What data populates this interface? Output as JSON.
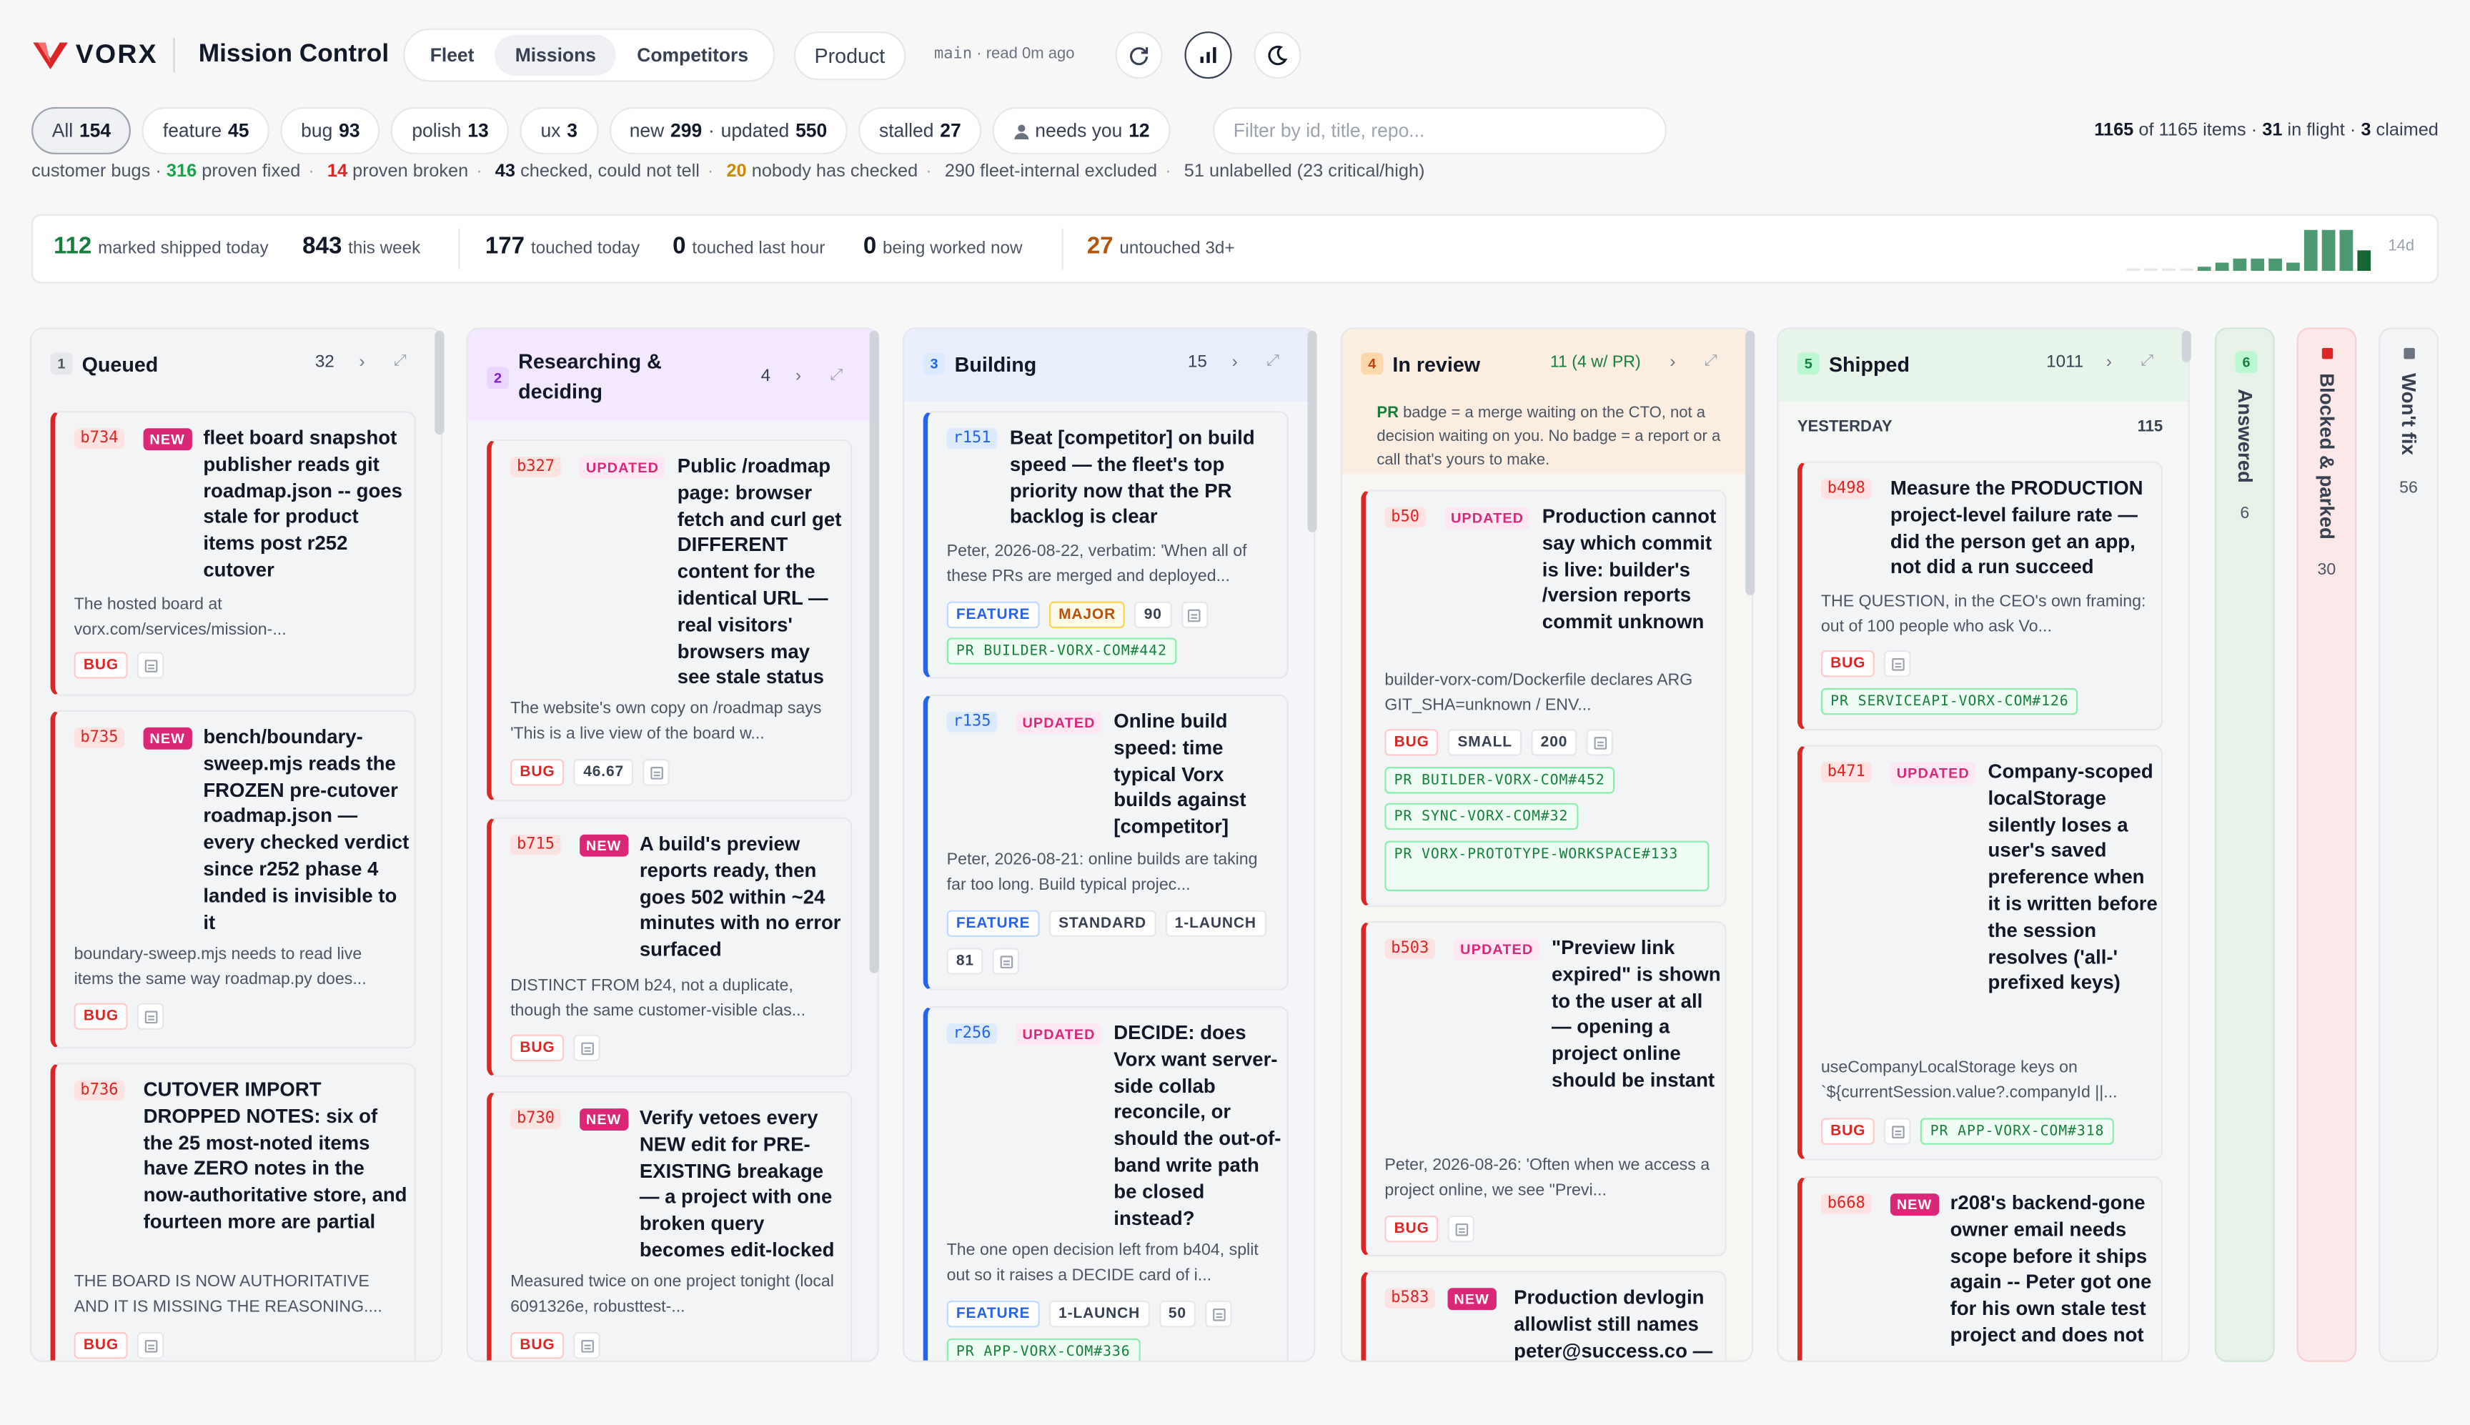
{
  "brand": {
    "wordmark": "VORX",
    "app_title": "Mission Control"
  },
  "nav": {
    "tabs": [
      {
        "label": "Fleet"
      },
      {
        "label": "Missions"
      },
      {
        "label": "Competitors"
      }
    ]
  },
  "product_button": "Product",
  "branch": {
    "name": "main",
    "status": "· read 0m ago"
  },
  "icons": {
    "refresh": "refresh-icon",
    "stats": "bar-chart-icon",
    "theme": "moon-icon"
  },
  "filters": {
    "all": {
      "label": "All",
      "count": "154"
    },
    "feature": {
      "label": "feature",
      "count": "45"
    },
    "bug": {
      "label": "bug",
      "count": "93"
    },
    "polish": {
      "label": "polish",
      "count": "13"
    },
    "ux": {
      "label": "ux",
      "count": "3"
    },
    "newupd": {
      "new_label": "new",
      "new_count": "299",
      "sep": "·",
      "upd_label": "updated",
      "upd_count": "550"
    },
    "stalled": {
      "label": "stalled",
      "count": "27"
    },
    "needs": {
      "label": "needs you",
      "count": "12"
    },
    "search_placeholder": "Filter by id, title, repo..."
  },
  "counts": {
    "shown": "1165",
    "of_label": "of",
    "total": "1165",
    "items_label": "items ·",
    "inflight": "31",
    "inflight_label": "in flight ·",
    "claimed": "3",
    "claimed_label": "claimed"
  },
  "subline": {
    "lead": "customer bugs ·",
    "proven_fixed": "316",
    "proven_fixed_label": "proven fixed",
    "proven_broken": "14",
    "proven_broken_label": "proven broken",
    "checked": "43",
    "checked_label": "checked, could not tell",
    "nobody": "20",
    "nobody_label": "nobody has checked",
    "excluded": "290 fleet-internal excluded",
    "unlabelled": "51 unlabelled (23 critical/high)"
  },
  "stats": {
    "shipped_today": "112",
    "shipped_today_label": "marked shipped today",
    "this_week": "843",
    "this_week_label": "this week",
    "touched_today": "177",
    "touched_today_label": "touched today",
    "touched_hour": "0",
    "touched_hour_label": "touched last hour",
    "being_worked": "0",
    "being_worked_label": "being worked now",
    "untouched": "27",
    "untouched_label": "untouched 3d+",
    "spark_label": "14d",
    "spark_values": [
      0,
      0,
      0,
      0,
      1,
      2,
      3,
      3,
      3,
      2,
      10,
      10,
      10,
      5
    ]
  },
  "columns": {
    "queued": {
      "num": "1",
      "title": "Queued",
      "count": "32"
    },
    "research": {
      "num": "2",
      "title": "Researching &",
      "title2": "deciding",
      "count": "4"
    },
    "building": {
      "num": "3",
      "title": "Building",
      "count": "15"
    },
    "review": {
      "num": "4",
      "title": "In review",
      "count": "11 (4 w/ PR)",
      "note_pr": "PR",
      "note_text": " badge = a merge waiting on the CTO, not a decision waiting on you. No badge = a report or a call that's yours to make."
    },
    "shipped": {
      "num": "5",
      "title": "Shipped",
      "count": "1011",
      "yesterday": "YESTERDAY",
      "yesterday_count": "115"
    },
    "answered": {
      "num": "6",
      "title": "Answered",
      "count": "6"
    },
    "blocked": {
      "title": "Blocked & parked",
      "count": "30"
    },
    "wontfix": {
      "title": "Won't fix",
      "count": "56"
    }
  },
  "cards": {
    "q1": {
      "id": "b734",
      "badge": "NEW",
      "title": "fleet board snapshot publisher reads git roadmap.json -- goes stale for product items post r252 cutover",
      "desc": "The hosted board at vorx.com/services/mission-...",
      "tags": [
        "BUG"
      ]
    },
    "q2": {
      "id": "b735",
      "badge": "NEW",
      "title": "bench/boundary-sweep.mjs reads the FROZEN pre-cutover roadmap.json — every checked verdict since r252 phase 4 landed is invisible to it",
      "desc": "boundary-sweep.mjs needs to read live items the same way roadmap.py does...",
      "tags": [
        "BUG"
      ]
    },
    "q3": {
      "id": "b736",
      "title": "CUTOVER IMPORT DROPPED NOTES: six of the 25 most-noted items have ZERO notes in the now-authoritative store, and fourteen more are partial",
      "desc": "THE BOARD IS NOW AUTHORITATIVE AND IT IS MISSING THE REASONING....",
      "tags": [
        "BUG"
      ]
    },
    "r1": {
      "id": "b327",
      "badge": "UPDATED",
      "title": "Public /roadmap page: browser fetch and curl get DIFFERENT content for the identical URL — real visitors' browsers may see stale status",
      "desc": "The website's own copy on /roadmap says 'This is a live view of the board w...",
      "tags": [
        "BUG",
        "46.67"
      ]
    },
    "r2": {
      "id": "b715",
      "badge": "NEW",
      "title": "A build's preview reports ready, then goes 502 within ~24 minutes with no error surfaced",
      "desc": "DISTINCT FROM b24, not a duplicate, though the same customer-visible clas...",
      "tags": [
        "BUG"
      ]
    },
    "r3": {
      "id": "b730",
      "badge": "NEW",
      "title": "Verify vetoes every NEW edit for PRE-EXISTING breakage — a project with one broken query becomes edit-locked",
      "desc": "Measured twice on one project tonight (local 6091326e, robusttest-...",
      "tags": [
        "BUG"
      ]
    },
    "b1": {
      "id": "r151",
      "title": "Beat [competitor] on build speed — the fleet's top priority now that the PR backlog is clear",
      "desc": "Peter, 2026-08-22, verbatim: 'When all of these PRs are merged and deployed...",
      "tags": [
        "FEATURE",
        "MAJOR",
        "90"
      ],
      "pr": "PR BUILDER-VORX-COM#442"
    },
    "b2": {
      "id": "r135",
      "badge": "UPDATED",
      "title": "Online build speed: time typical Vorx builds against [competitor]",
      "desc": "Peter, 2026-08-21: online builds are taking far too long. Build typical projec...",
      "tags": [
        "FEATURE",
        "STANDARD",
        "1-LAUNCH"
      ],
      "tags2": [
        "81"
      ]
    },
    "b3": {
      "id": "r256",
      "badge": "UPDATED",
      "title": "DECIDE: does Vorx want server-side collab reconcile, or should the out-of-band write path be closed instead?",
      "desc": "The one open decision left from b404, split out so it raises a DECIDE card of i...",
      "tags": [
        "FEATURE",
        "1-LAUNCH",
        "50"
      ],
      "pr": "PR APP-VORX-COM#336"
    },
    "v1": {
      "id": "b50",
      "badge": "UPDATED",
      "title": "Production cannot say which commit is live: builder's /version reports commit unknown",
      "desc": "builder-vorx-com/Dockerfile declares ARG GIT_SHA=unknown / ENV...",
      "tags": [
        "BUG",
        "SMALL",
        "200"
      ],
      "prs": [
        "PR BUILDER-VORX-COM#452",
        "PR SYNC-VORX-COM#32",
        "PR VORX-PROTOTYPE-WORKSPACE#133"
      ]
    },
    "v2": {
      "id": "b503",
      "badge": "UPDATED",
      "title": "\"Preview link expired\" is shown to the user at all — opening a project online should be instant",
      "desc": "Peter, 2026-08-26: 'Often when we access a project online, we see \"Previ...",
      "tags": [
        "BUG"
      ]
    },
    "v3": {
      "id": "b583",
      "badge": "NEW",
      "title": "Production devlogin allowlist still names peter@success.co —",
      "desc": "",
      "tags": []
    },
    "s1": {
      "id": "b498",
      "title": "Measure the PRODUCTION project-level failure rate — did the person get an app, not did a run succeed",
      "desc": "THE QUESTION, in the CEO's own framing: out of 100 people who ask Vo...",
      "tags": [
        "BUG"
      ],
      "pr": "PR SERVICEAPI-VORX-COM#126"
    },
    "s2": {
      "id": "b471",
      "badge": "UPDATED",
      "title": "Company-scoped localStorage silently loses a user's saved preference when it is written before the session resolves ('all-' prefixed keys)",
      "desc": "useCompanyLocalStorage keys on `${currentSession.value?.companyId ||...",
      "tags": [
        "BUG"
      ],
      "pr": "PR APP-VORX-COM#318"
    },
    "s3": {
      "id": "b668",
      "badge": "NEW",
      "title": "r208's backend-gone owner email needs scope before it ships again -- Peter got one for his own stale test project and does not",
      "desc": "",
      "tags": []
    }
  },
  "colors": {
    "accent": "#db2777",
    "bug": "#dc2626",
    "feature": "#2563eb",
    "shipped": "#15803d",
    "stalled": "#b45309"
  }
}
